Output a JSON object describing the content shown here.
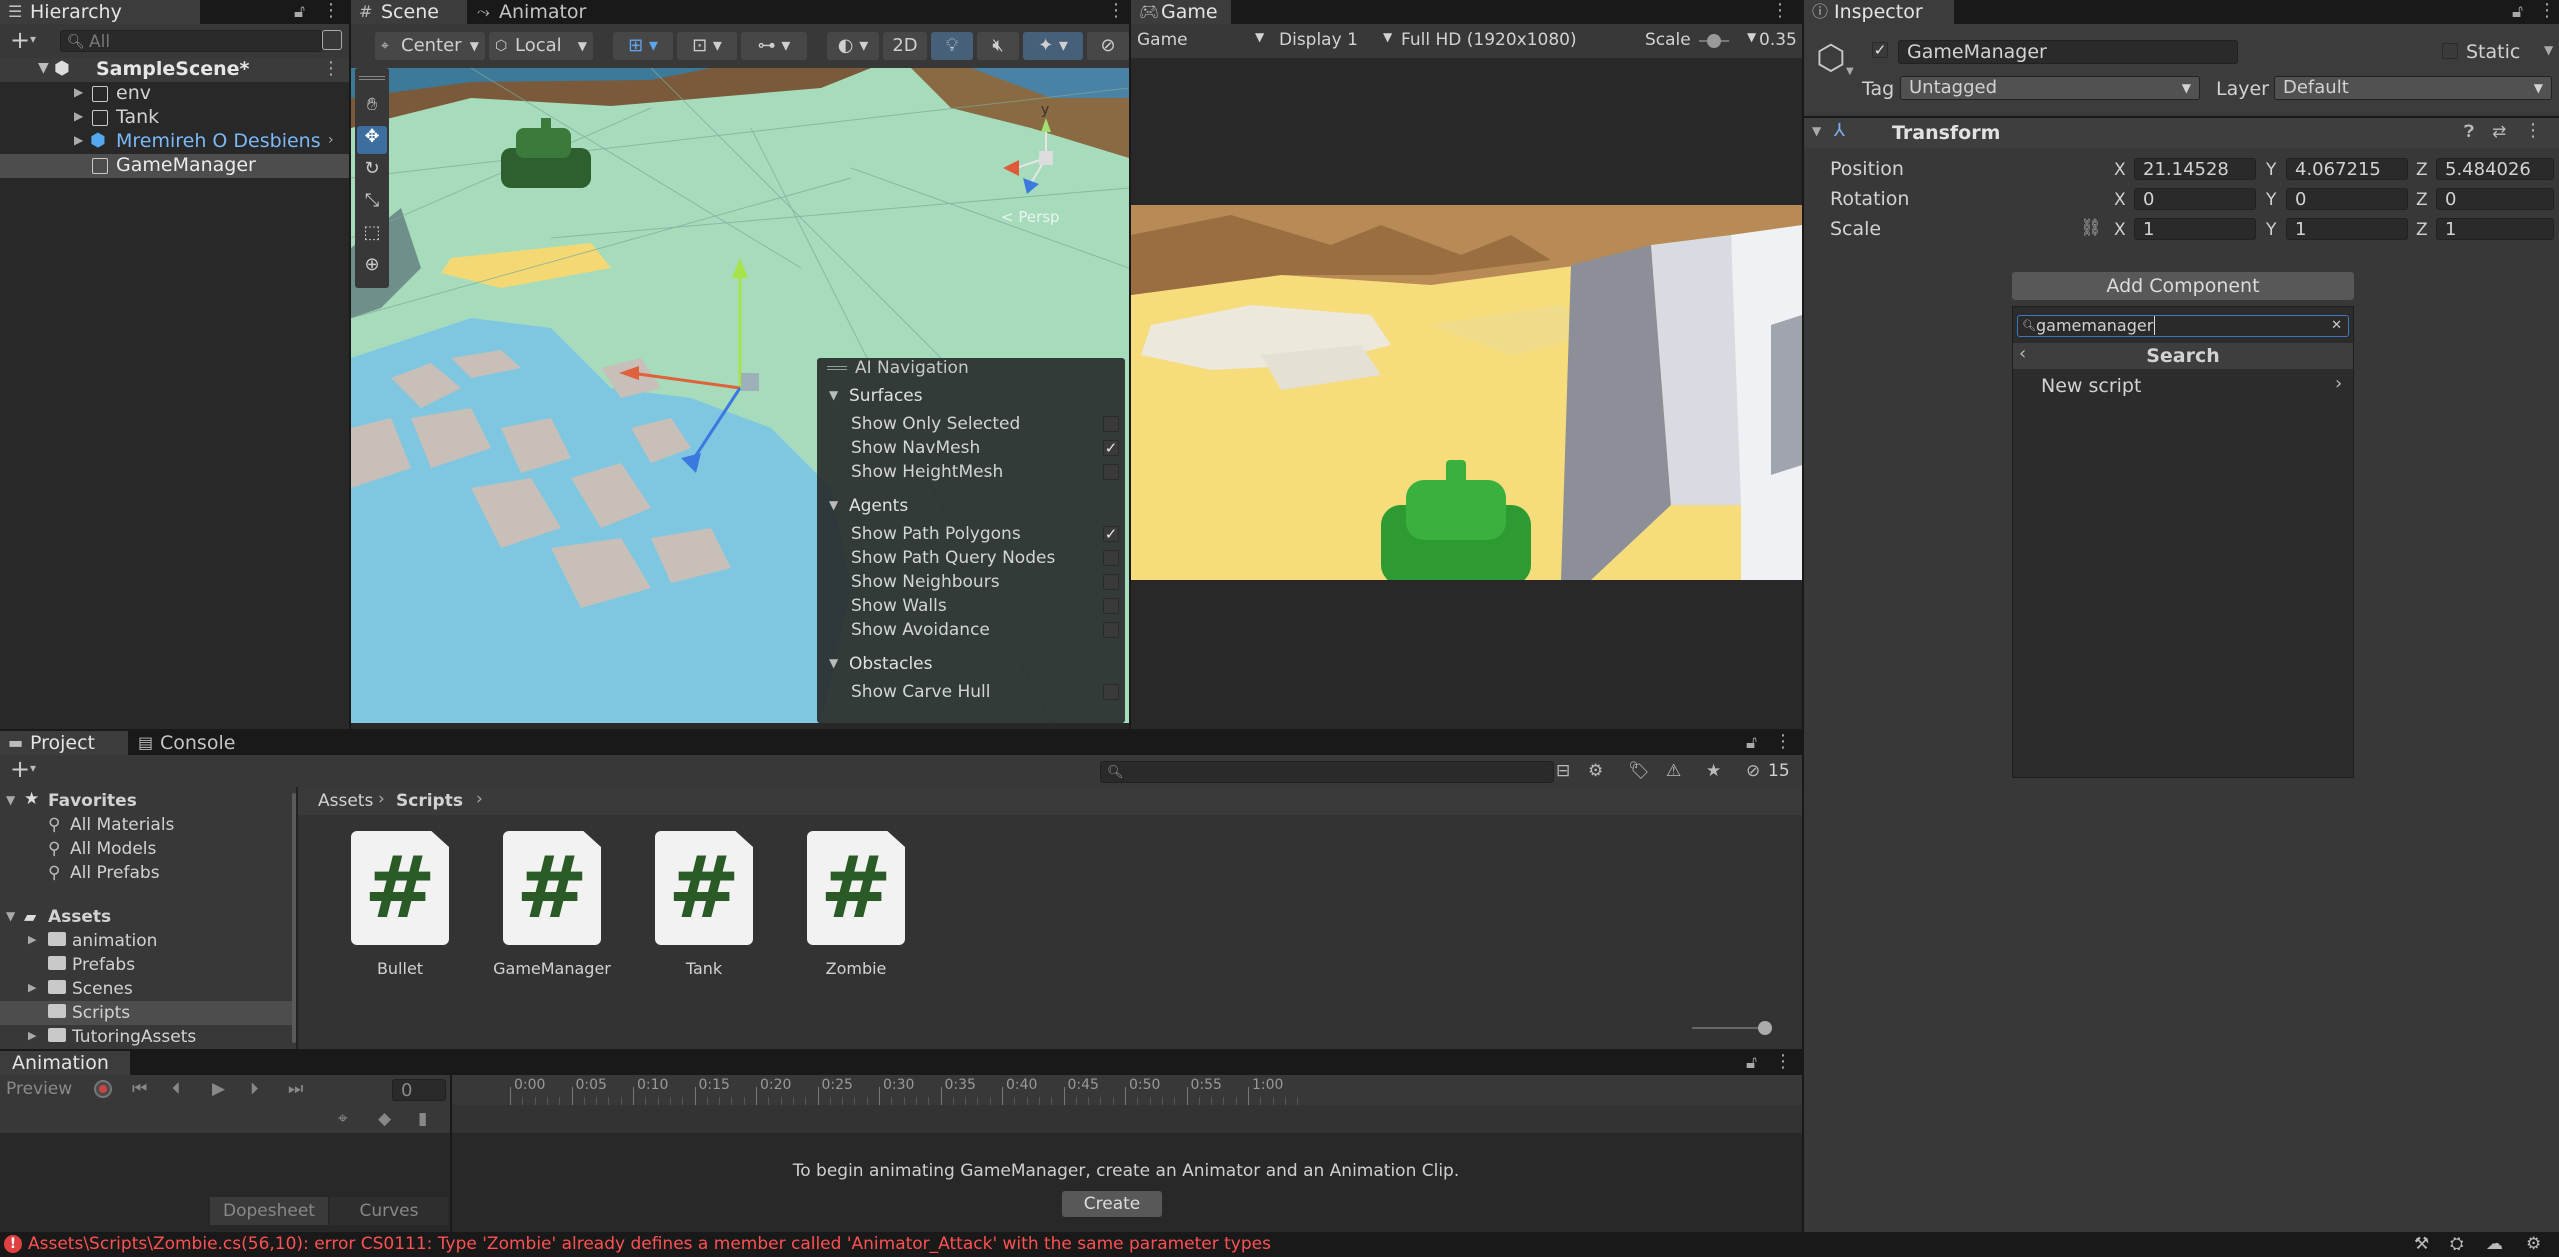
{
  "hierarchy": {
    "tab": "Hierarchy",
    "search_placeholder": "All",
    "scene": "SampleScene*",
    "items": [
      {
        "label": "env"
      },
      {
        "label": "Tank"
      },
      {
        "label": "Mremireh O Desbiens"
      },
      {
        "label": "GameManager"
      }
    ]
  },
  "scene_view": {
    "tabs": [
      "Scene",
      "Animator"
    ],
    "pivot": "Center",
    "space": "Local",
    "mode_2d": "2D",
    "persp_label": "< Persp",
    "ai_nav": {
      "title": "AI Navigation",
      "sections": [
        {
          "title": "Surfaces",
          "items": [
            {
              "label": "Show Only Selected",
              "checked": false
            },
            {
              "label": "Show NavMesh",
              "checked": true
            },
            {
              "label": "Show HeightMesh",
              "checked": false
            }
          ]
        },
        {
          "title": "Agents",
          "items": [
            {
              "label": "Show Path Polygons",
              "checked": true
            },
            {
              "label": "Show Path Query Nodes",
              "checked": false
            },
            {
              "label": "Show Neighbours",
              "checked": false
            },
            {
              "label": "Show Walls",
              "checked": false
            },
            {
              "label": "Show Avoidance",
              "checked": false
            }
          ]
        },
        {
          "title": "Obstacles",
          "items": [
            {
              "label": "Show Carve Hull",
              "checked": false
            }
          ]
        }
      ]
    }
  },
  "game_view": {
    "tab": "Game",
    "mode": "Game",
    "display": "Display 1",
    "resolution": "Full HD (1920x1080)",
    "scale_label": "Scale",
    "scale_value": "0.35"
  },
  "inspector": {
    "tab": "Inspector",
    "object_name": "GameManager",
    "static_label": "Static",
    "tag_label": "Tag",
    "tag_value": "Untagged",
    "layer_label": "Layer",
    "layer_value": "Default",
    "transform_title": "Transform",
    "position": {
      "label": "Position",
      "x": "21.14528",
      "y": "4.067215",
      "z": "5.484026"
    },
    "rotation": {
      "label": "Rotation",
      "x": "0",
      "y": "0",
      "z": "0"
    },
    "scale": {
      "label": "Scale",
      "x": "1",
      "y": "1",
      "z": "1"
    },
    "axis": {
      "x": "X",
      "y": "Y",
      "z": "Z"
    },
    "add_component": "Add Component",
    "search_value": "gamemanager",
    "search_header": "Search",
    "new_script": "New script"
  },
  "project": {
    "tabs": [
      "Project",
      "Console"
    ],
    "favorites_title": "Favorites",
    "favorites": [
      "All Materials",
      "All Models",
      "All Prefabs"
    ],
    "assets_title": "Assets",
    "folders": [
      "animation",
      "Prefabs",
      "Scenes",
      "Scripts",
      "TutoringAssets"
    ],
    "breadcrumb": [
      "Assets",
      "Scripts"
    ],
    "hidden_count": "15",
    "files": [
      "Bullet",
      "GameManager",
      "Tank",
      "Zombie"
    ]
  },
  "animation": {
    "tab": "Animation",
    "preview": "Preview",
    "frame": "0",
    "ticks": [
      "0:00",
      "0:05",
      "0:10",
      "0:15",
      "0:20",
      "0:25",
      "0:30",
      "0:35",
      "0:40",
      "0:45",
      "0:50",
      "0:55",
      "1:00"
    ],
    "message": "To begin animating GameManager, create an Animator and an Animation Clip.",
    "create": "Create",
    "dopesheet": "Dopesheet",
    "curves": "Curves"
  },
  "status": {
    "error": "Assets\\Scripts\\Zombie.cs(56,10): error CS0111: Type 'Zombie' already defines a member called 'Animator_Attack' with the same parameter types"
  },
  "colors": {
    "accent": "#3a79bb",
    "error": "#ff5151",
    "script_icon": "#2a5b26",
    "prefab_text": "#7bb8f7"
  }
}
